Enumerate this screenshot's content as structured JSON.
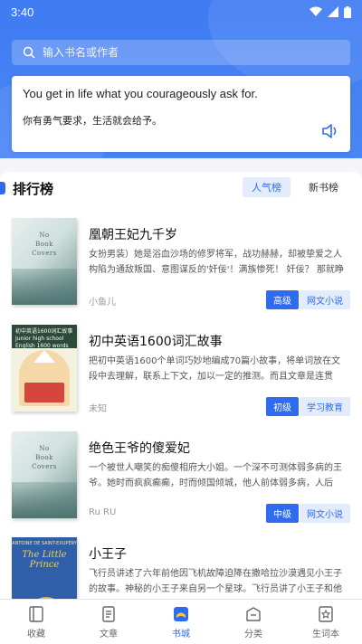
{
  "status": {
    "time": "3:40"
  },
  "search": {
    "placeholder": "输入书名或作者"
  },
  "quote": {
    "english": "You get in life what you courageously ask for.",
    "chinese": "你有勇气要求，生活就会给予。"
  },
  "ranking": {
    "title": "排行榜",
    "tabs": [
      {
        "label": "人气榜",
        "active": true
      },
      {
        "label": "新书榜",
        "active": false
      }
    ]
  },
  "books": [
    {
      "title": "凰朝王妃九千岁",
      "desc": "女扮男装）她是浴血沙场的修罗将军，战功赫赫，却被挚爱之人构陷为通敌叛国、意图谋反的'奸佞'！满族惨死！ 奸佞？ 那就睁大…",
      "author": "小鱼儿",
      "level": "高级",
      "category": "网文小说",
      "cover": {
        "line1": "No",
        "line2": "Book",
        "line3": "Covers"
      }
    },
    {
      "title": "初中英语1600词汇故事",
      "desc": "把初中英语1600个单词巧妙地编成70篇小故事，将单词放在文段中去理解，联系上下文，加以一定的推测。而且文章是连贯的、具…",
      "author": "未知",
      "level": "初级",
      "category": "学习教育",
      "cover": {
        "line1": "初中英语1600词汇故事",
        "line2": "Junior high school English 1600 words"
      }
    },
    {
      "title": "绝色王爷的傻爱妃",
      "desc": "一个被世人嘲笑的痴傻相府大小姐。一个深不可测体弱多病的王爷。她时而疯疯癫癫，时而倾国倾城，他人前体弱多病，人后似…",
      "author": "Ru RU",
      "level": "中级",
      "category": "网文小说",
      "cover": {
        "line1": "No",
        "line2": "Book",
        "line3": "Covers"
      }
    },
    {
      "title": "小王子",
      "desc": "飞行员讲述了六年前他因飞机故障迫降在撒哈拉沙漠遇见小王子的故事。神秘的小王子来自另一个星球。飞行员讲了小王子和他的…",
      "author": "",
      "level": "",
      "category": "",
      "cover": {
        "line1": "ANTOINE DE SAINT-EXUPÉRY",
        "line2": "The Little Prince"
      }
    }
  ],
  "tabbar": [
    {
      "label": "收藏",
      "icon": "bookmark-book-icon",
      "active": false
    },
    {
      "label": "文章",
      "icon": "article-icon",
      "active": false
    },
    {
      "label": "书城",
      "icon": "bookstore-icon",
      "active": true
    },
    {
      "label": "分类",
      "icon": "category-icon",
      "active": false
    },
    {
      "label": "生词本",
      "icon": "vocabulary-icon",
      "active": false
    }
  ],
  "colors": {
    "primary": "#2f6bef",
    "header": "#4b86f5"
  }
}
